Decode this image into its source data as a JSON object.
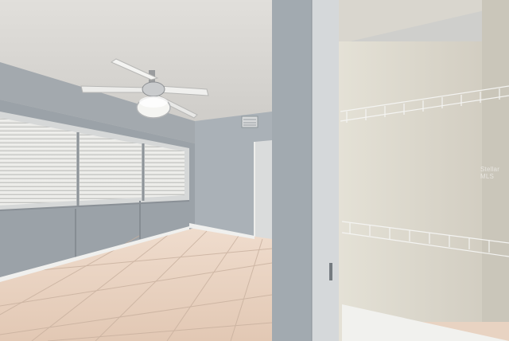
{
  "watermark": "Stellar MLS",
  "colors": {
    "ceiling": "#dcdad6",
    "wall_blue_gray": "#9ea6ad",
    "wall_light": "#c9ccce",
    "floor_tile": "#e6cfbd",
    "closet_wall": "#d8d4c8",
    "baseboard": "#f2f2ef"
  },
  "icons": [
    "ceiling-fan-icon",
    "wall-vent-icon",
    "window-blinds-icon",
    "wire-shelf-icon"
  ]
}
